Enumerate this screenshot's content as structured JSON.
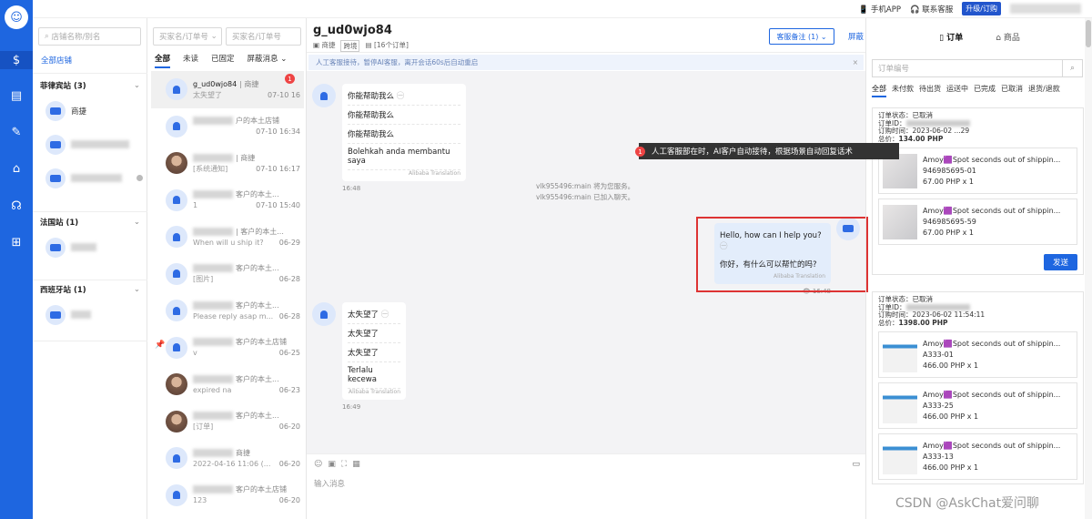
{
  "topbar": {
    "mobile_app": "手机APP",
    "contact_support": "联系客服",
    "upgrade": "升级/订购"
  },
  "sidebar": {
    "icons": [
      "robot-logo",
      "shop-icon",
      "doc-icon",
      "edit-icon",
      "store-icon",
      "headset-icon",
      "apps-icon"
    ]
  },
  "shops": {
    "search_placeholder": "店铺名称/别名",
    "all_shops": "全部店铺",
    "groups": [
      {
        "name": "菲律宾站 (3)",
        "items": [
          "商捷"
        ]
      },
      {
        "name": "法国站 (1)"
      },
      {
        "name": "西班牙站 (1)"
      }
    ]
  },
  "chats": {
    "search_buyer_placeholder": "买家名/订单号",
    "search_seller_placeholder": "买家名/订单号",
    "tabs": [
      "全部",
      "未读",
      "已固定",
      "屏蔽消息"
    ],
    "items": [
      {
        "name": "g_ud0wjo84",
        "shop": "| 商捷",
        "preview": "太失望了",
        "time": "07-10 16",
        "badge": "1"
      },
      {
        "name": "",
        "shop": "户的本土店铺",
        "preview": "",
        "time": "07-10 16:34"
      },
      {
        "name": "",
        "shop": "| 商捷",
        "preview": "[系统通知]",
        "time": "07-10 16:17"
      },
      {
        "name": "",
        "shop": "客户的本土...",
        "preview": "1",
        "time": "07-10 15:40"
      },
      {
        "name": "",
        "shop": "| 客户的本土...",
        "preview": "When will u ship it?",
        "time": "06-29"
      },
      {
        "name": "",
        "shop": "客户的本土...",
        "preview": "[图片]",
        "time": "06-28"
      },
      {
        "name": "",
        "shop": "客户的本土...",
        "preview": "Please reply asap m...",
        "time": "06-28"
      },
      {
        "name": "",
        "shop": "客户的本土店铺",
        "preview": "v",
        "time": "06-25"
      },
      {
        "name": "",
        "shop": "客户的本土...",
        "preview": "expired na",
        "time": "06-23"
      },
      {
        "name": "",
        "shop": "客户的本土...",
        "preview": "[订单]",
        "time": "06-20"
      },
      {
        "name": "",
        "shop": "商捷",
        "preview": "2022-04-16 11:06 (...",
        "time": "06-20"
      },
      {
        "name": "",
        "shop": "客户的本土店铺",
        "preview": "123",
        "time": "06-20"
      }
    ]
  },
  "conversation": {
    "name": "g_ud0wjo84",
    "shop": "商捷",
    "tag": "跨境",
    "orders": "[16个订单]",
    "note_button": "客服备注 (1)",
    "block": "屏蔽",
    "notice": "人工客服接待，暂停AI客服，离开会话60s后自动重启",
    "msg1": {
      "lines": [
        "你能帮助我么",
        "你能帮助我么",
        "你能帮助我么",
        "Bolehkah anda membantu saya"
      ],
      "translator": "Alibaba Translation",
      "time": "16:48"
    },
    "system1": "vlk955496:main 将为您服务。",
    "system2": "vlk955496:main 已加入聊天。",
    "tooltip": "人工客服部在时，AI客户自动接待，根据场景自动回复话术",
    "tooltip_badge": "1",
    "msg2": {
      "lines": [
        "Hello, how can I help you?",
        "你好，有什么可以帮忙的吗?"
      ],
      "translator": "Alibaba Translation",
      "time": "16:48"
    },
    "msg3": {
      "lines": [
        "太失望了",
        "太失望了",
        "太失望了",
        "Terlalu kecewa"
      ],
      "translator": "Alibaba Translation",
      "time": "16:49"
    },
    "input_placeholder": "输入消息"
  },
  "orders": {
    "tabs": [
      "订单",
      "商品"
    ],
    "search_placeholder": "订单编号",
    "filters": [
      "全部",
      "未付款",
      "待出货",
      "运送中",
      "已完成",
      "已取消",
      "退货/退款"
    ],
    "labels": {
      "status": "订单状态：",
      "id": "订单ID：",
      "time": "订购时间：",
      "total": "总价："
    },
    "send": "发送",
    "cards": [
      {
        "status": "已取消",
        "time": "2023-06-02 ...29",
        "total": "134.00 PHP",
        "products": [
          {
            "title": "Amoy🟪Spot seconds out of shippin...",
            "sku": "946985695-01",
            "price": "67.00 PHP x 1"
          },
          {
            "title": "Amoy🟪Spot seconds out of shippin...",
            "sku": "946985695-59",
            "price": "67.00 PHP x 1"
          }
        ]
      },
      {
        "status": "已取消",
        "time": "2023-06-02 11:54:11",
        "total": "1398.00 PHP",
        "products": [
          {
            "title": "Amoy🟪Spot seconds out of shippin...",
            "sku": "A333-01",
            "price": "466.00 PHP x 1"
          },
          {
            "title": "Amoy🟪Spot seconds out of shippin...",
            "sku": "A333-25",
            "price": "466.00 PHP x 1"
          },
          {
            "title": "Amoy🟪Spot seconds out of shippin...",
            "sku": "A333-13",
            "price": "466.00 PHP x 1"
          }
        ]
      }
    ]
  },
  "watermark": "CSDN @AskChat爱问聊"
}
